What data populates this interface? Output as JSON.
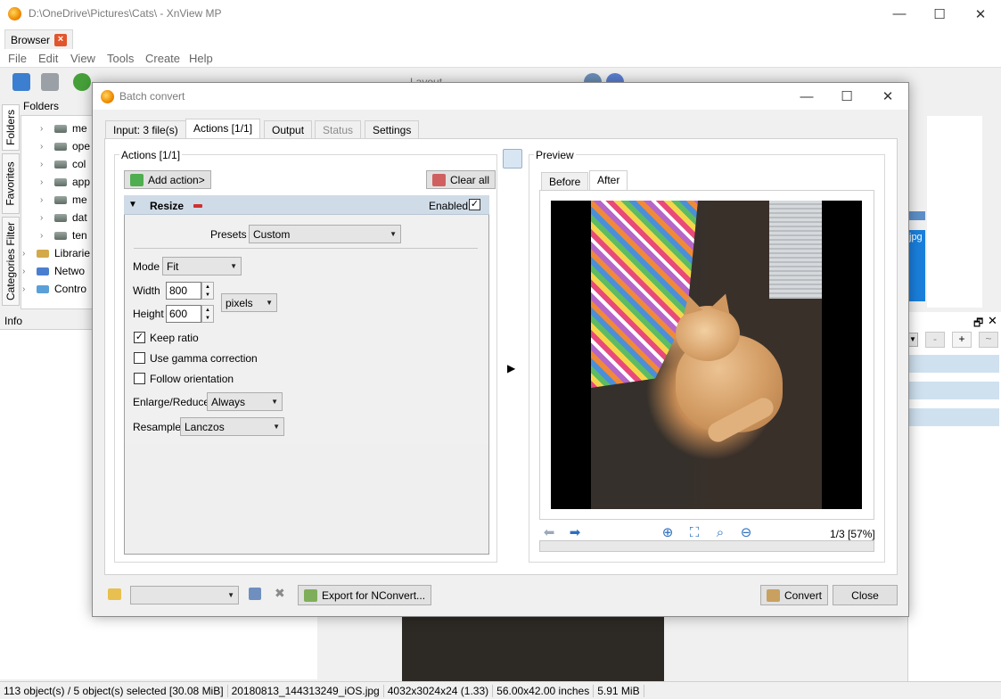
{
  "window": {
    "title": "D:\\OneDrive\\Pictures\\Cats\\ - XnView MP",
    "tab_label": "Browser",
    "min": "—",
    "max": "☐",
    "close": "✕"
  },
  "menu": [
    "File",
    "Edit",
    "View",
    "Tools",
    "Create",
    "Help"
  ],
  "toolbar": {
    "layout_label": "Layout"
  },
  "left_tabs": [
    "Folders",
    "Favorites",
    "Categories Filter"
  ],
  "folders": {
    "header": "Folders",
    "items": [
      {
        "label": "me"
      },
      {
        "label": "ope"
      },
      {
        "label": "col"
      },
      {
        "label": "app"
      },
      {
        "label": "me"
      },
      {
        "label": "dat"
      },
      {
        "label": "ten"
      },
      {
        "label": "Librarie"
      },
      {
        "label": "Netwo"
      },
      {
        "label": "Contro"
      }
    ]
  },
  "info": {
    "label": "Info"
  },
  "right": {
    "file_ext": "jpg",
    "minus": "-",
    "plus": "+",
    "tilde": "~"
  },
  "statusbar": [
    "113 object(s) / 5 object(s) selected [30.08 MiB]",
    "20180813_144313249_iOS.jpg",
    "4032x3024x24 (1.33)",
    "56.00x42.00 inches",
    "5.91 MiB"
  ],
  "dialog": {
    "title": "Batch convert",
    "min": "—",
    "max": "☐",
    "close": "✕",
    "tabs": [
      {
        "label": "Input: 3 file(s)",
        "state": "normal"
      },
      {
        "label": "Actions [1/1]",
        "state": "active"
      },
      {
        "label": "Output",
        "state": "normal"
      },
      {
        "label": "Status",
        "state": "disabled"
      },
      {
        "label": "Settings",
        "state": "normal"
      }
    ],
    "actions": {
      "group_label": "Actions [1/1]",
      "add_action": "Add action>",
      "clear_all": "Clear all",
      "action_name": "Resize",
      "enabled_label": "Enabled",
      "enabled_checked": "✓",
      "presets_label": "Presets",
      "presets_value": "Custom",
      "mode_label": "Mode",
      "mode_value": "Fit",
      "width_label": "Width",
      "width_value": "800",
      "height_label": "Height",
      "height_value": "600",
      "unit_value": "pixels",
      "keep_ratio": {
        "label": "Keep ratio",
        "checked": "✓"
      },
      "gamma": {
        "label": "Use gamma correction",
        "checked": ""
      },
      "orientation": {
        "label": "Follow orientation",
        "checked": ""
      },
      "enlarge_label": "Enlarge/Reduce",
      "enlarge_value": "Always",
      "resample_label": "Resample",
      "resample_value": "Lanczos"
    },
    "preview": {
      "group_label": "Preview",
      "tabs": [
        "Before",
        "After"
      ],
      "active_tab": "After",
      "page_info": "1/3 [57%]"
    },
    "footer": {
      "export": "Export for NConvert...",
      "convert": "Convert",
      "close": "Close"
    }
  },
  "colors": {
    "accent_blue": "#1a7fdc",
    "action_header": "#cfdbe6",
    "app_icon": "#f08a00"
  }
}
